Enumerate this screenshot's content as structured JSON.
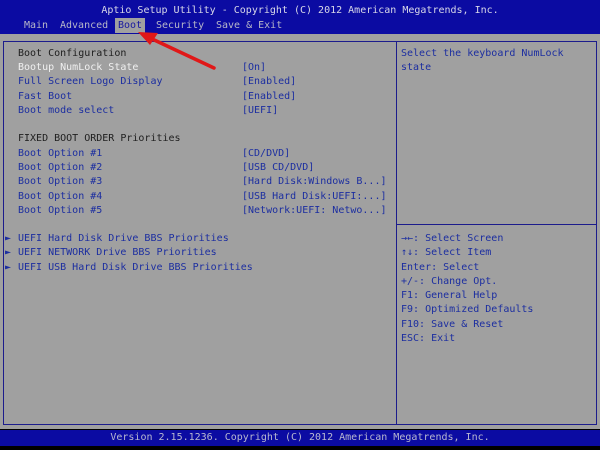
{
  "title": "Aptio Setup Utility - Copyright (C) 2012 American Megatrends, Inc.",
  "tabs": [
    {
      "label": "Main"
    },
    {
      "label": "Advanced"
    },
    {
      "label": "Boot",
      "active": true
    },
    {
      "label": "Security"
    },
    {
      "label": "Save & Exit"
    }
  ],
  "main": {
    "boot_config_header": "Boot Configuration",
    "settings": [
      {
        "label": "Bootup NumLock State",
        "value": "[On]",
        "selected": true
      },
      {
        "label": "Full Screen Logo Display",
        "value": "[Enabled]"
      },
      {
        "label": "Fast Boot",
        "value": "[Enabled]"
      },
      {
        "label": "Boot mode select",
        "value": "[UEFI]"
      }
    ],
    "boot_order_header": "FIXED BOOT ORDER Priorities",
    "boot_options": [
      {
        "label": "Boot Option #1",
        "value": "[CD/DVD]"
      },
      {
        "label": "Boot Option #2",
        "value": "[USB CD/DVD]"
      },
      {
        "label": "Boot Option #3",
        "value": "[Hard Disk:Windows B...]"
      },
      {
        "label": "Boot Option #4",
        "value": "[USB Hard Disk:UEFI:...]"
      },
      {
        "label": "Boot Option #5",
        "value": "[Network:UEFI: Netwo...]"
      }
    ],
    "submenus": [
      {
        "label": "UEFI Hard Disk Drive BBS Priorities"
      },
      {
        "label": "UEFI NETWORK Drive BBS Priorities"
      },
      {
        "label": "UEFI USB Hard Disk Drive BBS Priorities"
      }
    ],
    "submenu_marker": "►"
  },
  "help": {
    "description": "Select the keyboard NumLock\nstate",
    "keys": [
      "→←: Select Screen",
      "↑↓: Select Item",
      "Enter: Select",
      "+/-: Change Opt.",
      "F1: General Help",
      "F9: Optimized Defaults",
      "F10: Save & Reset",
      "ESC: Exit"
    ]
  },
  "footer": "Version 2.15.1236. Copyright (C) 2012 American Megatrends, Inc.",
  "colors": {
    "bar_blue": "#0b0ba2",
    "panel_gray": "#a0a0a0",
    "text_blue": "#1c2ea0",
    "arrow_red": "#e01818"
  }
}
